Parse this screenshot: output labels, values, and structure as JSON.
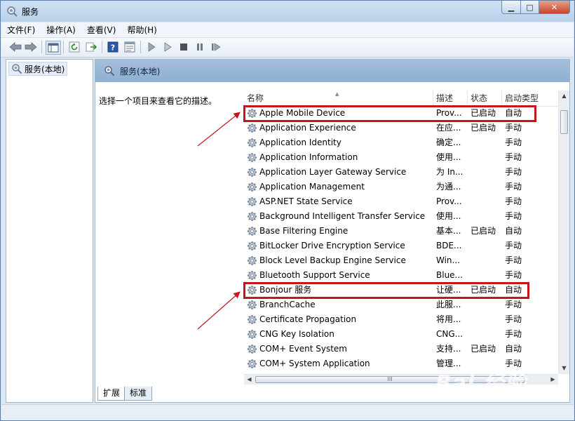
{
  "window": {
    "title": "服务",
    "controls": {
      "minimize": "▁",
      "maximize": "□",
      "close": "✕"
    }
  },
  "menu": [
    "文件(F)",
    "操作(A)",
    "查看(V)",
    "帮助(H)"
  ],
  "toolbar_icons": [
    "back-arrow-icon",
    "forward-arrow-icon",
    "console-tree-icon",
    "refresh-icon",
    "export-list-icon",
    "help-icon",
    "properties-icon",
    "start-service-icon",
    "start-service-alt-icon",
    "stop-service-icon",
    "pause-service-icon",
    "restart-service-icon"
  ],
  "tree": {
    "selected": "服务(本地)"
  },
  "pane": {
    "header_title": "服务(本地)",
    "description_prompt": "选择一个项目来查看它的描述。"
  },
  "table": {
    "columns": [
      "名称",
      "描述",
      "状态",
      "启动类型"
    ],
    "rows": [
      {
        "name": "Apple Mobile Device",
        "desc": "Prov...",
        "status": "已启动",
        "startup": "自动",
        "highlighted": true
      },
      {
        "name": "Application Experience",
        "desc": "在应...",
        "status": "已启动",
        "startup": "手动"
      },
      {
        "name": "Application Identity",
        "desc": "确定...",
        "status": "",
        "startup": "手动"
      },
      {
        "name": "Application Information",
        "desc": "使用...",
        "status": "",
        "startup": "手动"
      },
      {
        "name": "Application Layer Gateway Service",
        "desc": "为 In...",
        "status": "",
        "startup": "手动"
      },
      {
        "name": "Application Management",
        "desc": "为通...",
        "status": "",
        "startup": "手动"
      },
      {
        "name": "ASP.NET State Service",
        "desc": "Prov...",
        "status": "",
        "startup": "手动"
      },
      {
        "name": "Background Intelligent Transfer Service",
        "desc": "使用...",
        "status": "",
        "startup": "手动"
      },
      {
        "name": "Base Filtering Engine",
        "desc": "基本...",
        "status": "已启动",
        "startup": "自动"
      },
      {
        "name": "BitLocker Drive Encryption Service",
        "desc": "BDE...",
        "status": "",
        "startup": "手动"
      },
      {
        "name": "Block Level Backup Engine Service",
        "desc": "Win...",
        "status": "",
        "startup": "手动"
      },
      {
        "name": "Bluetooth Support Service",
        "desc": "Blue...",
        "status": "",
        "startup": "手动"
      },
      {
        "name": "Bonjour 服务",
        "desc": "让硬...",
        "status": "已启动",
        "startup": "自动",
        "highlighted": true
      },
      {
        "name": "BranchCache",
        "desc": "此服...",
        "status": "",
        "startup": "手动"
      },
      {
        "name": "Certificate Propagation",
        "desc": "将用...",
        "status": "",
        "startup": "手动"
      },
      {
        "name": "CNG Key Isolation",
        "desc": "CNG...",
        "status": "",
        "startup": "手动"
      },
      {
        "name": "COM+ Event System",
        "desc": "支持...",
        "status": "已启动",
        "startup": "自动"
      },
      {
        "name": "COM+ System Application",
        "desc": "管理...",
        "status": "",
        "startup": "手动"
      }
    ]
  },
  "tabs": [
    "扩展",
    "标准"
  ],
  "scroll": {
    "up": "▲",
    "down": "▼",
    "left": "◀",
    "right": "▶",
    "grip": "III"
  },
  "watermark": "Bai 经验",
  "colors": {
    "highlight_box": "#c4171d"
  }
}
